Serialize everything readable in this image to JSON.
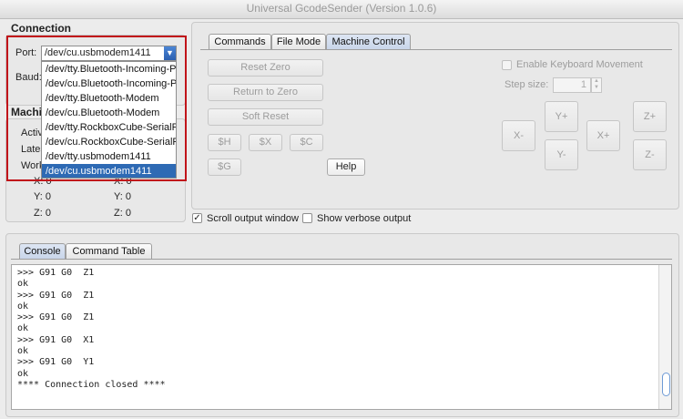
{
  "window": {
    "title": "Universal GcodeSender (Version 1.0.6)"
  },
  "connection": {
    "label": "Connection",
    "port_label": "Port:",
    "port_value": "/dev/cu.usbmodem1411",
    "baud_label": "Baud:",
    "port_options": [
      "/dev/tty.Bluetooth-Incoming-P",
      "/dev/cu.Bluetooth-Incoming-P",
      "/dev/tty.Bluetooth-Modem",
      "/dev/cu.Bluetooth-Modem",
      "/dev/tty.RockboxCube-SerialP",
      "/dev/cu.RockboxCube-SerialP",
      "/dev/tty.usbmodem1411",
      "/dev/cu.usbmodem1411"
    ],
    "selected_index": 7
  },
  "machine_status": {
    "label": "Machi",
    "active_label": "Activ",
    "latest_label": "Lates",
    "work_label": "Work",
    "work": {
      "x": "X:  0",
      "y": "Y:  0",
      "z": "Z:  0"
    },
    "machine": {
      "x": "X:  0",
      "y": "Y:  0",
      "z": "Z:  0"
    }
  },
  "tabs": {
    "commands": "Commands",
    "file_mode": "File Mode",
    "machine_control": "Machine Control",
    "active": "machine_control"
  },
  "machine_control": {
    "reset_zero": "Reset Zero",
    "return_to_zero": "Return to Zero",
    "soft_reset": "Soft Reset",
    "h": "$H",
    "x": "$X",
    "c": "$C",
    "g": "$G",
    "help": "Help",
    "enable_keyboard": "Enable Keyboard Movement",
    "step_size_label": "Step size:",
    "step_size_value": "1",
    "jog": {
      "x_minus": "X-",
      "x_plus": "X+",
      "y_plus": "Y+",
      "y_minus": "Y-",
      "z_plus": "Z+",
      "z_minus": "Z-"
    }
  },
  "output_options": {
    "scroll_output": "Scroll output window",
    "scroll_checked": true,
    "verbose_output": "Show verbose output",
    "verbose_checked": false
  },
  "bottom_tabs": {
    "console": "Console",
    "command_table": "Command Table",
    "active": "console"
  },
  "console": {
    "lines": [
      ">>> G91 G0  Z1",
      "ok",
      ">>> G91 G0  Z1",
      "ok",
      ">>> G91 G0  Z1",
      "ok",
      ">>> G91 G0  X1",
      "ok",
      ">>> G91 G0  Y1",
      "ok",
      "**** Connection closed ****"
    ]
  },
  "colors": {
    "highlight": "#c1141a",
    "selection": "#2e6ab4",
    "tab_active": "#c9d6ea"
  }
}
